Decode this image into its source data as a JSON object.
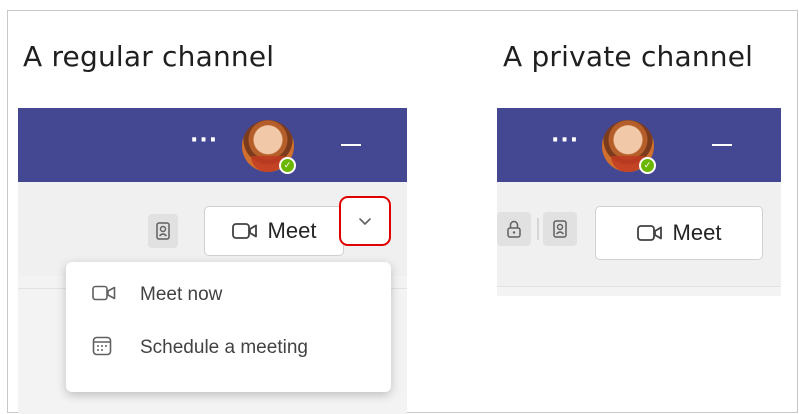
{
  "captions": {
    "regular": "A regular channel",
    "private": "A private channel"
  },
  "titlebar": {
    "more_dots": "···",
    "presence_check": "✓"
  },
  "toolbar": {
    "meet_label": "Meet"
  },
  "meet_menu": {
    "items": [
      {
        "label": "Meet now",
        "icon": "video-camera-icon"
      },
      {
        "label": "Schedule a meeting",
        "icon": "calendar-icon"
      }
    ]
  },
  "colors": {
    "titlebar": "#444791",
    "highlight": "#e00000",
    "presence": "#6bb700"
  }
}
